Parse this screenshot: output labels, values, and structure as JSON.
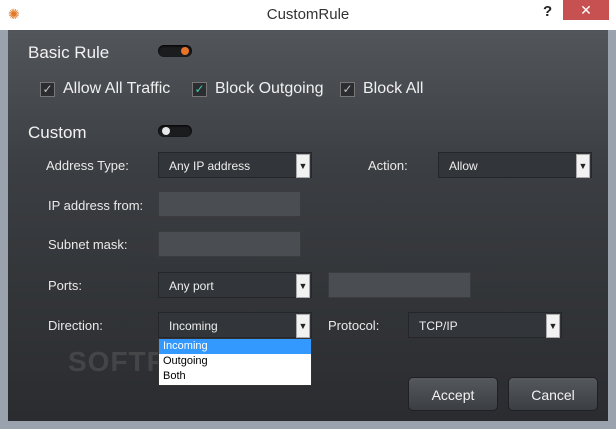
{
  "window": {
    "title": "CustomRule",
    "help": "?",
    "close": "✕"
  },
  "basic_rule": {
    "label": "Basic Rule",
    "options": [
      {
        "label": "Allow All Traffic",
        "check": "✓"
      },
      {
        "label": "Block Outgoing",
        "check": "✓"
      },
      {
        "label": "Block All",
        "check": "✓"
      }
    ]
  },
  "custom": {
    "label": "Custom",
    "address_type": {
      "label": "Address Type:",
      "value": "Any IP address"
    },
    "action": {
      "label": "Action:",
      "value": "Allow"
    },
    "ip_from": {
      "label": "IP address from:"
    },
    "subnet": {
      "label": "Subnet mask:"
    },
    "ports": {
      "label": "Ports:",
      "value": "Any port"
    },
    "direction": {
      "label": "Direction:",
      "value": "Incoming",
      "options": [
        "Incoming",
        "Outgoing",
        "Both"
      ]
    },
    "protocol": {
      "label": "Protocol:",
      "value": "TCP/IP"
    }
  },
  "buttons": {
    "accept": "Accept",
    "cancel": "Cancel"
  },
  "watermark": "SOFTPEDIA",
  "colors": {
    "accent_on": "#e8742a",
    "check_accent": "#38d0a8",
    "close_bg": "#c75050",
    "selection": "#3399ff"
  }
}
